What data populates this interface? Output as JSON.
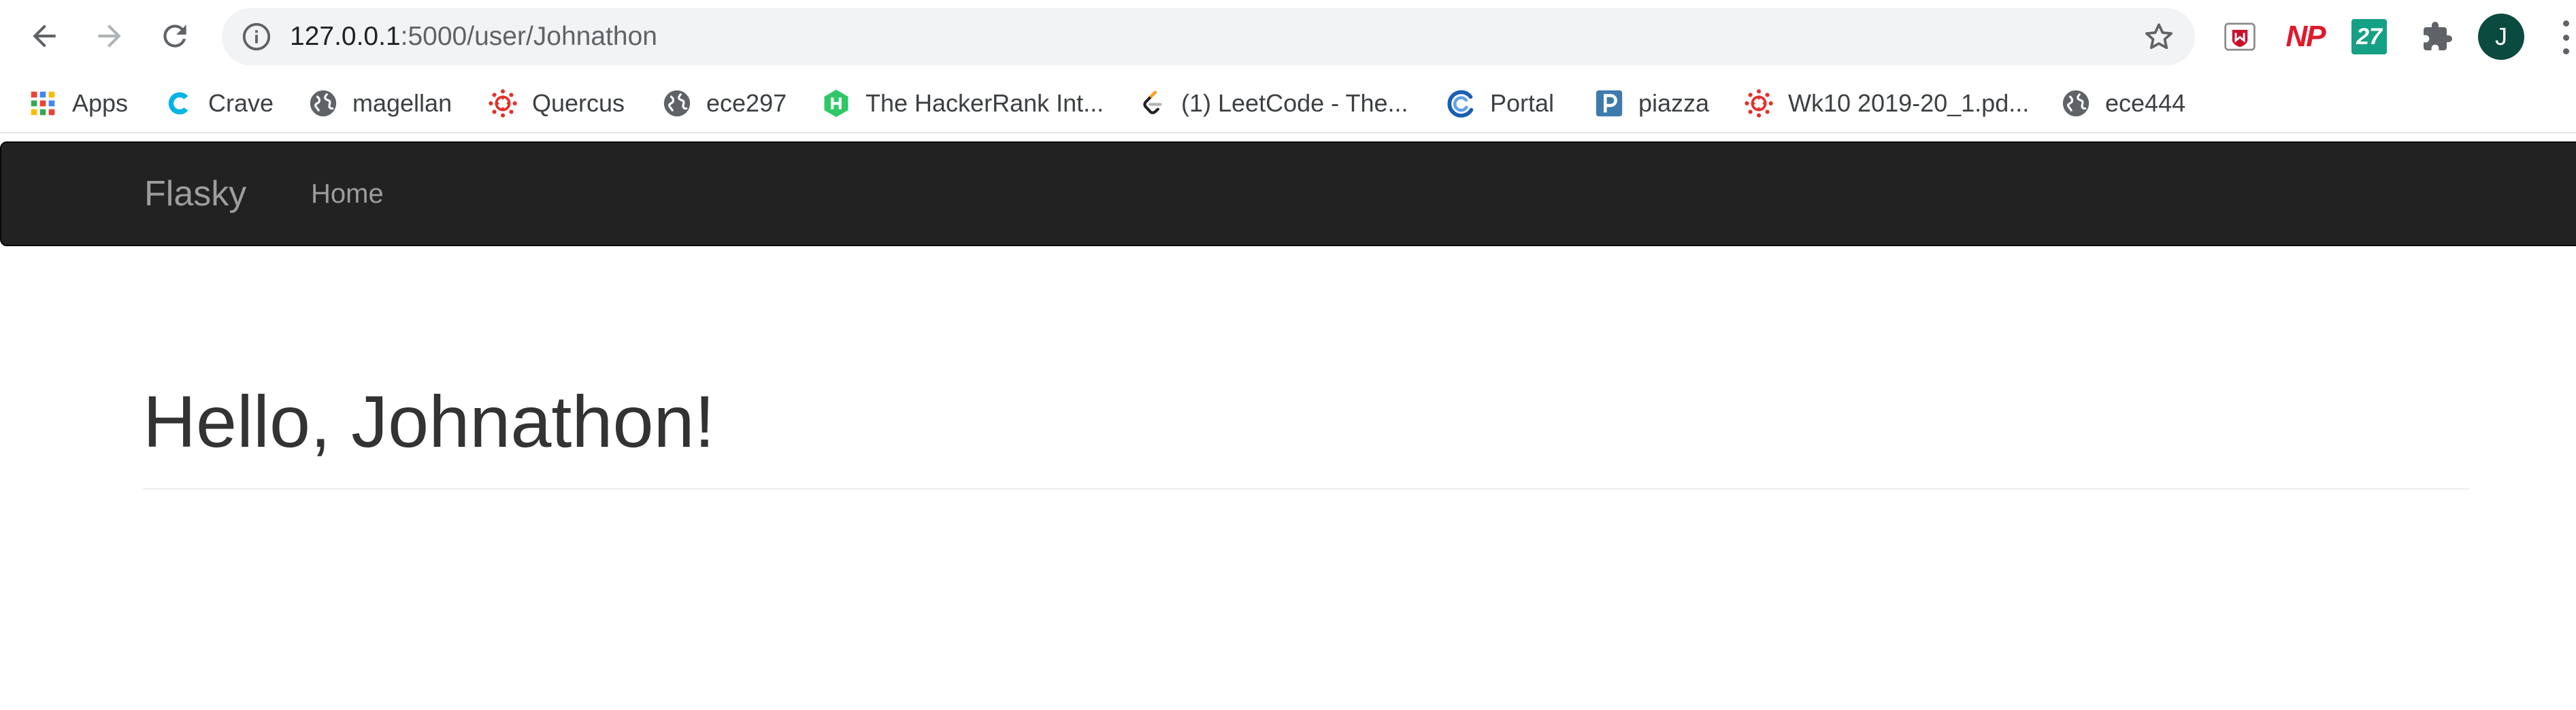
{
  "browser": {
    "url_host": "127.0.0.1",
    "url_path": ":5000/user/Johnathon",
    "profile_initial": "J",
    "extensions": [
      {
        "name": "mcafee-extension"
      },
      {
        "name": "np-extension",
        "label": "NP"
      },
      {
        "name": "27-extension",
        "label": "27"
      },
      {
        "name": "extensions-puzzle-icon"
      }
    ]
  },
  "bookmarks": [
    {
      "label": "Apps",
      "icon": "apps-grid-icon"
    },
    {
      "label": "Crave",
      "icon": "crave-icon"
    },
    {
      "label": "magellan",
      "icon": "globe-icon"
    },
    {
      "label": "Quercus",
      "icon": "canvas-icon"
    },
    {
      "label": "ece297",
      "icon": "globe-icon"
    },
    {
      "label": "The HackerRank Int...",
      "icon": "hackerrank-icon"
    },
    {
      "label": "(1) LeetCode - The...",
      "icon": "leetcode-icon"
    },
    {
      "label": "Portal",
      "icon": "portal-icon"
    },
    {
      "label": "piazza",
      "icon": "piazza-icon"
    },
    {
      "label": "Wk10 2019-20_1.pd...",
      "icon": "canvas-icon"
    },
    {
      "label": "ece444",
      "icon": "globe-icon"
    }
  ],
  "app": {
    "brand": "Flasky",
    "nav": {
      "home_label": "Home"
    },
    "greeting": "Hello, Johnathon!"
  },
  "colors": {
    "navbar_bg": "#222222",
    "navbar_text": "#9d9d9d",
    "heading_text": "#333333",
    "avatar_bg": "#0b4a3e"
  }
}
